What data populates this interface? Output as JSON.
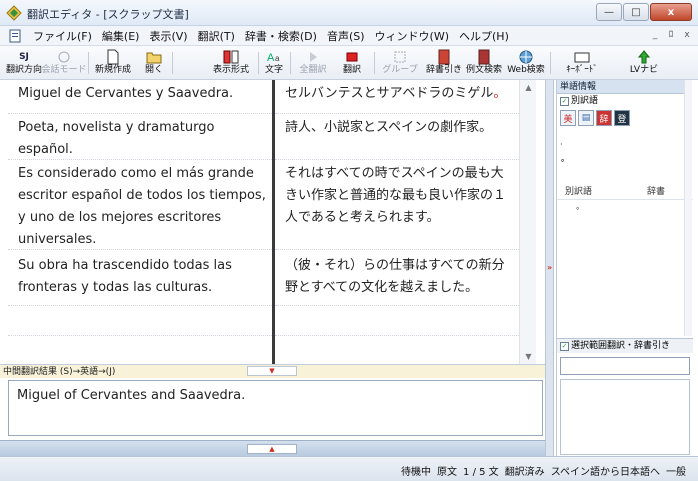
{
  "window": {
    "title": "翻訳エディタ - [スクラップ文書]",
    "controls": {
      "minimize": "—",
      "maximize": "□",
      "close": "x"
    }
  },
  "menu": {
    "items": [
      "ファイル(F)",
      "編集(E)",
      "表示(V)",
      "翻訳(T)",
      "辞書・検索(D)",
      "音声(S)",
      "ウィンドウ(W)",
      "ヘルプ(H)"
    ],
    "mdi": {
      "minimize": "_",
      "restore": "ﾛ",
      "close": "x"
    }
  },
  "toolbar": {
    "direction_label": "翻訳方向",
    "direction_top": "SJ",
    "conversation_label": "会話モード",
    "new_label": "新規作成",
    "open_label": "開く",
    "display_label": "表示形式",
    "font_label": "文字",
    "translate_all_label": "全翻訳",
    "translate_label": "翻訳",
    "group_label": "グループ",
    "dict_lookup_label": "辞書引き",
    "example_label": "例文検索",
    "web_label": "Web検索",
    "keyboard_label": "ｷｰﾎﾞｰﾄﾞ",
    "lv_label": "LVナビ"
  },
  "source_segments": [
    "Miguel de Cervantes y Saavedra.",
    "Poeta, novelista y dramaturgo español.",
    "Es considerado como el más grande escritor español de todos los tiempos, y uno de los mejores escritores universales.",
    "Su obra ha trascendido todas las fronteras y todas las culturas."
  ],
  "target_segments": [
    "セルバンテスとサアベドラのミゲル",
    "詩人、小説家とスペインの劇作家。",
    "それはすべての時でスペインの最も大きい作家と普通的な最も良い作家の１人であると考えられます。",
    "（彼・それ）らの仕事はすべての新分野とすべての文化を越えました。"
  ],
  "target_first_suffix": "。",
  "dictionary_panel": {
    "header": "単語情報",
    "other_words_checkbox": "別訳語",
    "column_other": "別訳語",
    "column_dict": "辞書",
    "selection_checkbox": "選択範囲翻訳・辞書引き"
  },
  "intermediate": {
    "header": "中間翻訳結果 (S)→英語→(J)",
    "text": "Miguel of Cervantes and Saavedra."
  },
  "status": {
    "state": "待機中",
    "mode": "原文",
    "sentence": "1 / 5 文",
    "translated": "翻訳済み",
    "direction": "スペイン語から日本語へ",
    "field": "一般"
  }
}
